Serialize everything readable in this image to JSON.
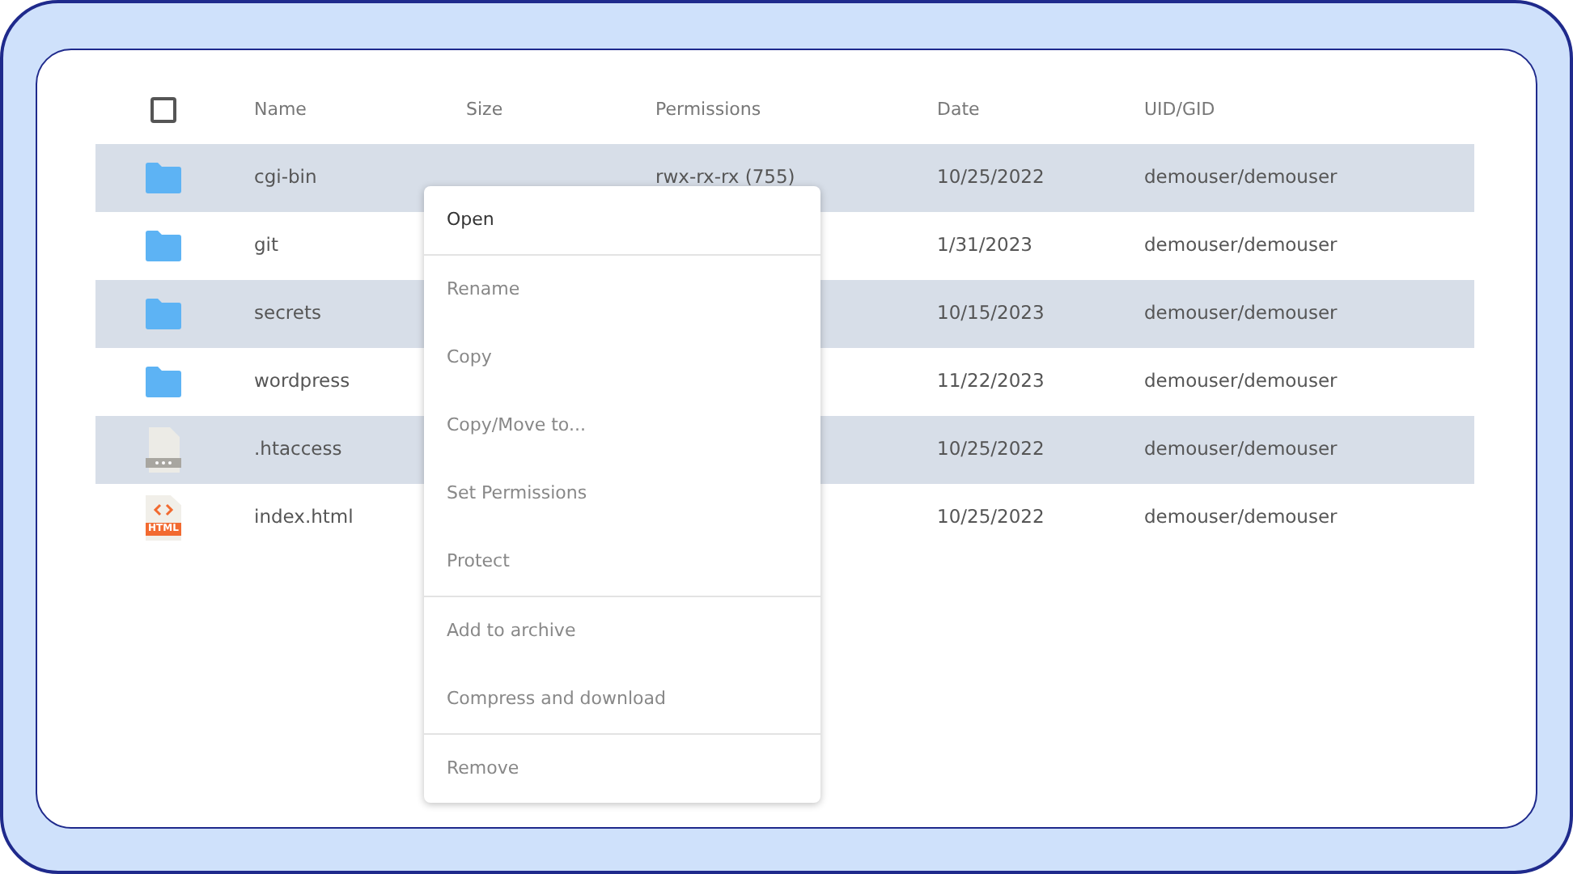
{
  "table": {
    "columns": [
      "Name",
      "Size",
      "Permissions",
      "Date",
      "UID/GID"
    ],
    "select_all": {
      "checked": false
    },
    "rows": [
      {
        "kind": "folder",
        "name": "cgi-bin",
        "permissions": "rwx-rx-rx (755)",
        "date": "10/25/2022",
        "owner": "demouser/demouser"
      },
      {
        "kind": "folder",
        "name": "git",
        "date": "1/31/2023",
        "owner": "demouser/demouser"
      },
      {
        "kind": "folder",
        "name": "secrets",
        "date": "10/15/2023",
        "owner": "demouser/demouser"
      },
      {
        "kind": "folder",
        "name": "wordpress",
        "date": "11/22/2023",
        "owner": "demouser/demouser"
      },
      {
        "kind": "file",
        "name": ".htaccess",
        "date": "10/25/2022",
        "owner": "demouser/demouser"
      },
      {
        "kind": "html",
        "name": "index.html",
        "date": "10/25/2022",
        "owner": "demouser/demouser",
        "icon_label": "HTML"
      }
    ]
  },
  "context_menu": {
    "groups": [
      [
        "Open"
      ],
      [
        "Rename",
        "Copy",
        "Copy/Move to...",
        "Set Permissions",
        "Protect"
      ],
      [
        "Add to archive",
        "Compress and download"
      ],
      [
        "Remove"
      ]
    ]
  }
}
